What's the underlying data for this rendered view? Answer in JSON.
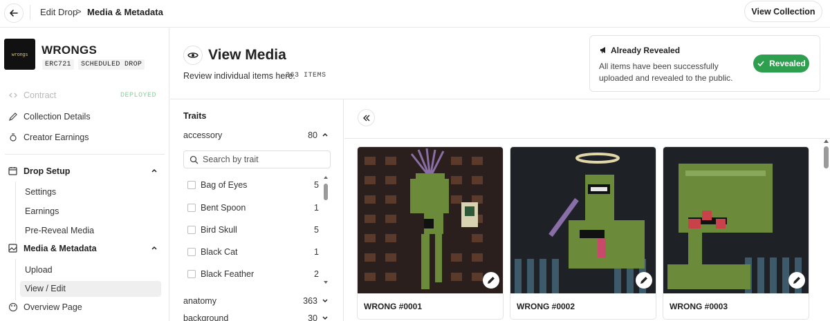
{
  "topbar": {
    "breadcrumb_parent": "Edit Drop",
    "breadcrumb_separator": ">",
    "breadcrumb_current": "Media & Metadata",
    "view_collection_label": "View Collection"
  },
  "collection": {
    "logo_text": "wrongs",
    "name": "WRONGS",
    "standard_badge": "ERC721",
    "status_badge": "SCHEDULED DROP"
  },
  "sidebar": {
    "contract_label": "Contract",
    "contract_status": "DEPLOYED",
    "collection_details_label": "Collection Details",
    "creator_earnings_label": "Creator Earnings",
    "drop_setup": {
      "label": "Drop Setup",
      "items": [
        "Settings",
        "Earnings",
        "Pre-Reveal Media"
      ]
    },
    "media_metadata": {
      "label": "Media & Metadata",
      "items": [
        "Upload",
        "View / Edit"
      ]
    },
    "overview_label": "Overview Page"
  },
  "header": {
    "title": "View Media",
    "subtitle": "Review individual items here.",
    "item_count": "363 ITEMS"
  },
  "reveal_card": {
    "title": "Already Revealed",
    "description": "All items have been successfully uploaded and revealed to the public.",
    "button_label": "Revealed",
    "accent_color": "#2e9e4f"
  },
  "traits": {
    "title": "Traits",
    "groups": [
      {
        "name": "accessory",
        "count": "80"
      },
      {
        "name": "anatomy",
        "count": "363"
      },
      {
        "name": "background",
        "count": "30"
      }
    ],
    "search_placeholder": "Search by trait",
    "accessory_items": [
      {
        "label": "Bag of Eyes",
        "count": "5"
      },
      {
        "label": "Bent Spoon",
        "count": "1"
      },
      {
        "label": "Bird Skull",
        "count": "5"
      },
      {
        "label": "Black Cat",
        "count": "1"
      },
      {
        "label": "Black Feather",
        "count": "2"
      }
    ]
  },
  "grid": {
    "items": [
      {
        "name": "WRONG #0001"
      },
      {
        "name": "WRONG #0002"
      },
      {
        "name": "WRONG #0003"
      }
    ]
  },
  "icons": {
    "back": "arrow-left-icon",
    "eye": "eye-icon",
    "collapse": "double-chevron-left-icon",
    "edit": "pencil-icon",
    "megaphone": "megaphone-icon",
    "check": "check-icon"
  }
}
